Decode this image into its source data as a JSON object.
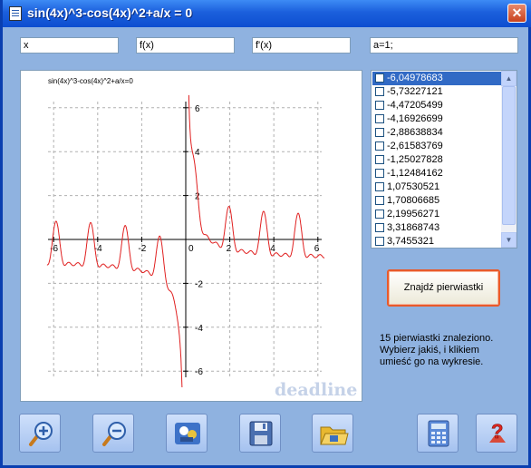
{
  "window": {
    "title": "sin(4x)^3-cos(4x)^2+a/x = 0"
  },
  "inputs": {
    "x_label": "x",
    "fx_label": "f(x)",
    "dfx_label": "f'(x)",
    "params": "a=1;"
  },
  "plot": {
    "caption": "sin(4x)^3-cos(4x)^2+a/x=0",
    "watermark": "deadline",
    "x_ticks": [
      "-6",
      "-4",
      "-2",
      "0",
      "2",
      "4",
      "6"
    ],
    "y_ticks": [
      "6",
      "4",
      "2",
      "-2",
      "-4",
      "-6"
    ],
    "curve_color": "#e02020",
    "grid_color": "#b0b0b0"
  },
  "roots_list": {
    "items": [
      "-6,04978683",
      "-5,73227121",
      "-4,47205499",
      "-4,16926699",
      "-2,88638834",
      "-2,61583769",
      "-1,25027828",
      "-1,12484162",
      "1,07530521",
      "1,70806685",
      "2,19956271",
      "3,31868743",
      "3,7455321"
    ],
    "selected_index": 0
  },
  "find_button": {
    "label": "Znajdź pierwiastki"
  },
  "status": {
    "line1": "15 pierwiastki znaleziono.",
    "line2": "Wybierz jakiś, i klikiem",
    "line3": "umieść go na wykresie."
  },
  "toolbar": {
    "icons": [
      "zoom-in-icon",
      "zoom-out-icon",
      "reset-view-icon",
      "save-icon",
      "open-icon",
      "calculator-icon",
      "help-icon"
    ]
  },
  "colors": {
    "window_bg": "#8fb2e0",
    "titlebar": "#1b5fdc",
    "selection": "#316ac5",
    "button_highlight": "#e85a2b"
  }
}
